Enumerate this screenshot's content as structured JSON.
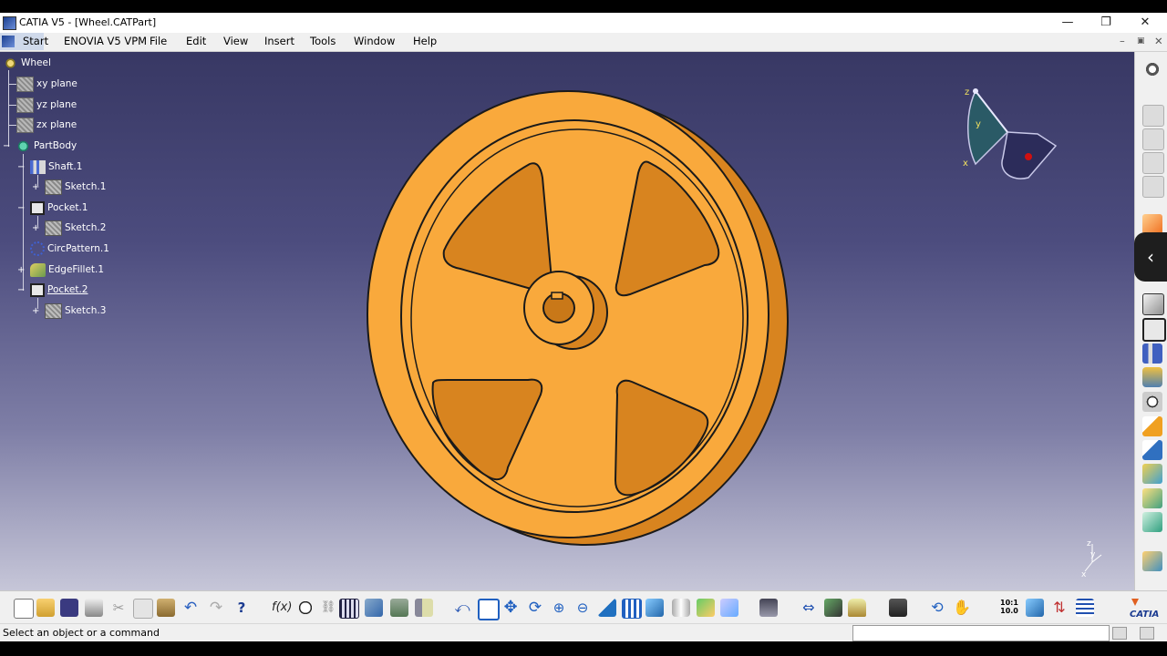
{
  "window": {
    "title": "CATIA V5 - [Wheel.CATPart]",
    "minimize_glyph": "—",
    "restore_glyph": "❐",
    "close_glyph": "✕"
  },
  "menu": {
    "start": "Start",
    "items": [
      "ENOVIA V5 VPM",
      "File",
      "Edit",
      "View",
      "Insert",
      "Tools",
      "Window",
      "Help"
    ],
    "doc_controls": [
      "–",
      "▣",
      "✕"
    ]
  },
  "tree": {
    "root": "Wheel",
    "items": [
      {
        "label": "xy plane",
        "icon": "plane-icon"
      },
      {
        "label": "yz plane",
        "icon": "plane-icon"
      },
      {
        "label": "zx plane",
        "icon": "plane-icon"
      },
      {
        "label": "PartBody",
        "icon": "partbody-icon"
      },
      {
        "label": "Shaft.1",
        "icon": "shaft-icon"
      },
      {
        "label": "Sketch.1",
        "icon": "sketch-icon"
      },
      {
        "label": "Pocket.1",
        "icon": "pocket-icon"
      },
      {
        "label": "Sketch.2",
        "icon": "sketch-icon"
      },
      {
        "label": "CircPattern.1",
        "icon": "circpattern-icon"
      },
      {
        "label": "EdgeFillet.1",
        "icon": "edgefillet-icon"
      },
      {
        "label": "Pocket.2",
        "icon": "pocket-icon"
      },
      {
        "label": "Sketch.3",
        "icon": "sketch-icon"
      }
    ]
  },
  "compass": {
    "z": "z",
    "y": "y",
    "x": "x"
  },
  "axis_triad": {
    "z": "z",
    "y": "y",
    "x": "x"
  },
  "zoom_label": {
    "top": "10:1",
    "bottom": "10.0"
  },
  "brand": "CATIA",
  "status": {
    "text": "Select an object or a command"
  },
  "colors": {
    "part": "#f9a93c",
    "part_shadow": "#d8841f",
    "viewport_top": "#383864",
    "viewport_bottom": "#c6c6d8",
    "chrome": "#f0f0f0"
  }
}
